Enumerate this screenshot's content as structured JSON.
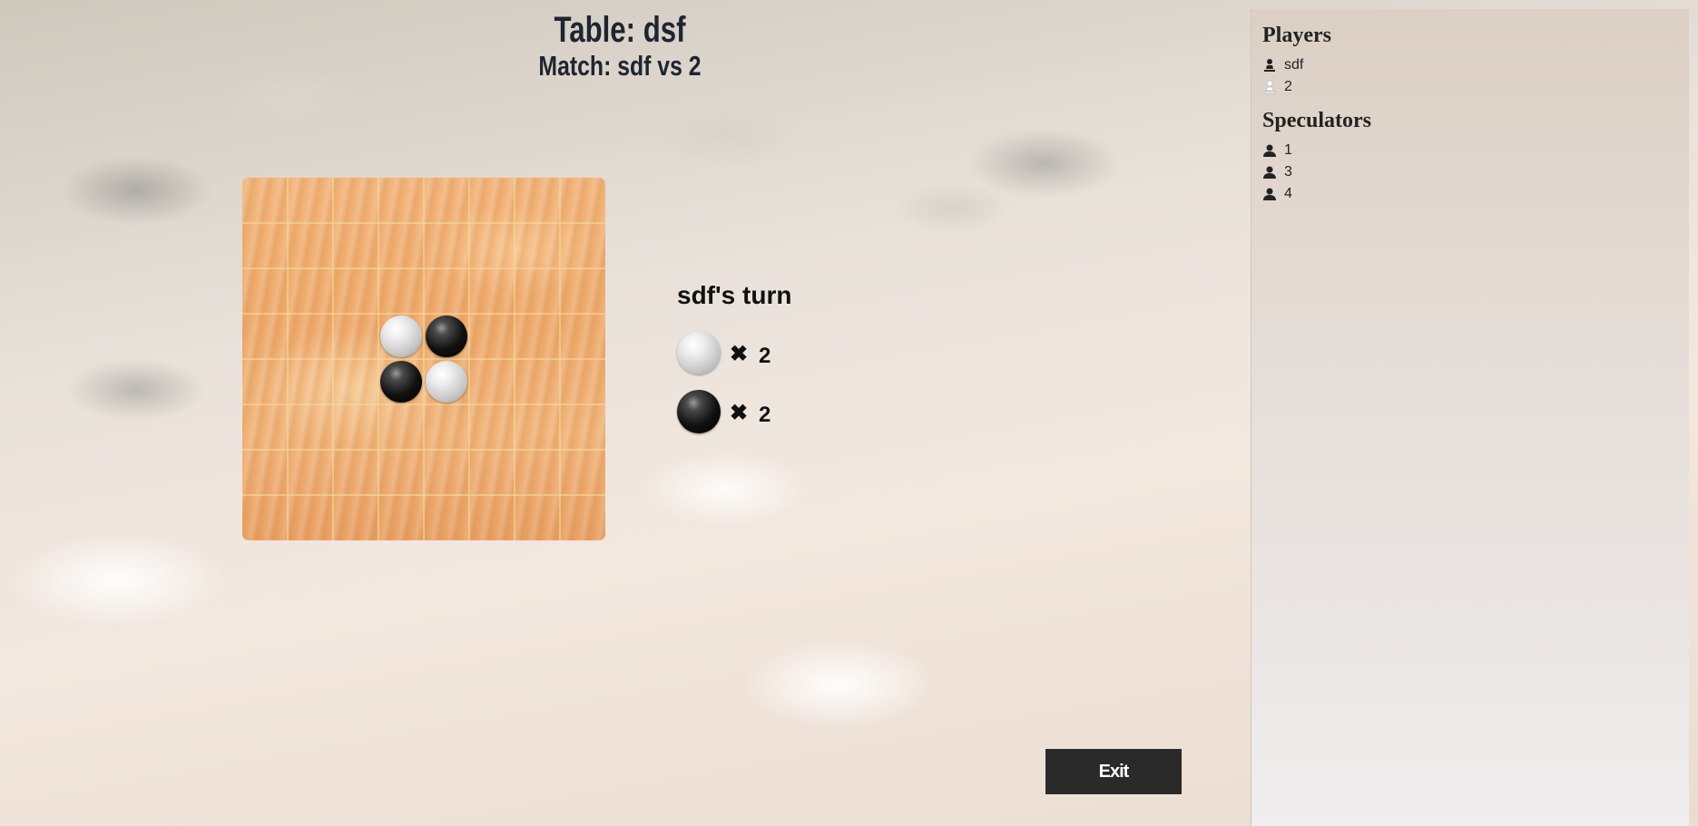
{
  "header": {
    "title": "Table: dsf",
    "subtitle": "Match: sdf vs 2"
  },
  "board": {
    "size": 8,
    "line_color": "#f7d79a",
    "stones": [
      {
        "row": 3,
        "col": 3,
        "color": "white"
      },
      {
        "row": 3,
        "col": 4,
        "color": "black"
      },
      {
        "row": 4,
        "col": 3,
        "color": "black"
      },
      {
        "row": 4,
        "col": 4,
        "color": "white"
      }
    ]
  },
  "status": {
    "turn_text": "sdf's turn",
    "times_symbol": "✖",
    "white_count": "2",
    "black_count": "2"
  },
  "exit_label": "Exit",
  "sidebar": {
    "players_title": "Players",
    "players": [
      {
        "name": "sdf",
        "icon": "black-pawn-icon"
      },
      {
        "name": "2",
        "icon": "white-pawn-icon"
      }
    ],
    "speculators_title": "Speculators",
    "speculators": [
      {
        "name": "1",
        "icon": "user-icon"
      },
      {
        "name": "3",
        "icon": "user-icon"
      },
      {
        "name": "4",
        "icon": "user-icon"
      }
    ]
  }
}
